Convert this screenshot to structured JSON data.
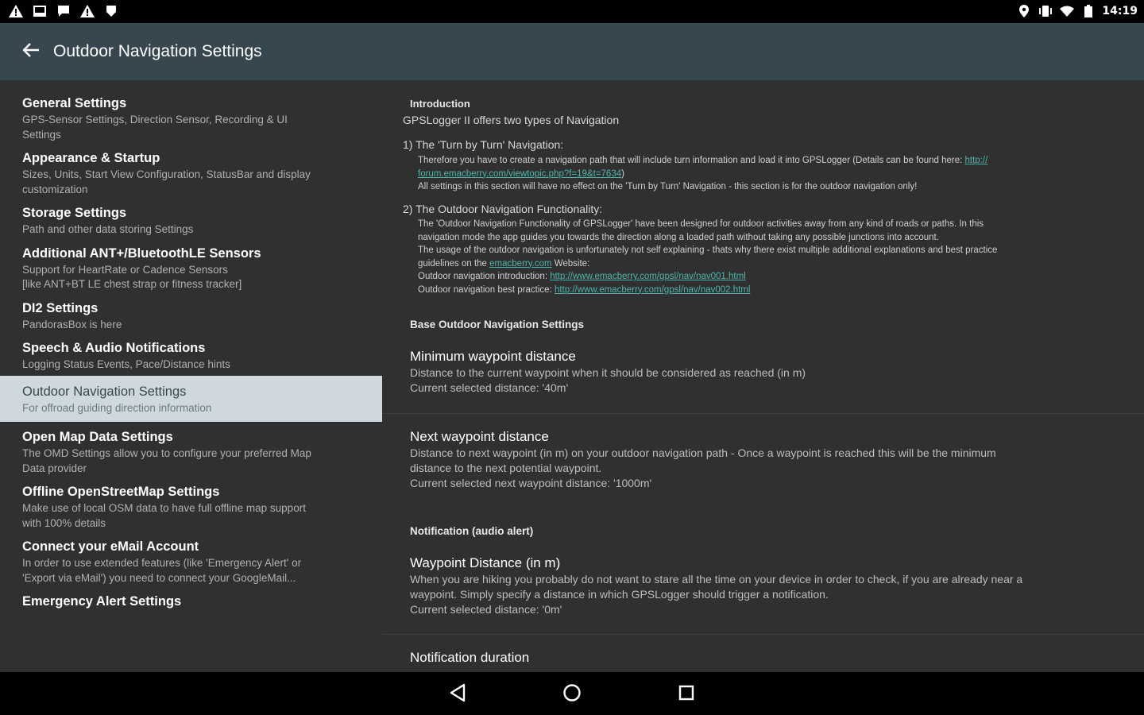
{
  "status_bar": {
    "left_icons": [
      "warning-icon",
      "image-icon",
      "chat-icon",
      "warning-icon",
      "alert-pin-icon"
    ],
    "right_icons": [
      "location-icon",
      "vibrate-icon",
      "wifi-icon",
      "battery-icon"
    ],
    "time": "14:19"
  },
  "app_bar": {
    "title": "Outdoor Navigation Settings",
    "back_icon": "arrow-back-icon",
    "background": "#37474f"
  },
  "sidebar": {
    "items": [
      {
        "title": "General Settings",
        "subtitle": "GPS-Sensor Settings, Direction Sensor, Recording & UI\nSettings"
      },
      {
        "title": "Appearance & Startup",
        "subtitle": "Sizes, Units, Start View Configuration, StatusBar and display\ncustomization"
      },
      {
        "title": "Storage Settings",
        "subtitle": "Path and other data storing Settings"
      },
      {
        "title": "Additional ANT+/BluetoothLE Sensors",
        "subtitle": "Support for HeartRate or Cadence Sensors\n[like ANT+BT LE chest strap or fitness tracker]"
      },
      {
        "title": "DI2 Settings",
        "subtitle": "PandorasBox is here"
      },
      {
        "title": "Speech & Audio Notifications",
        "subtitle": "Logging Status Events, Pace/Distance hints"
      },
      {
        "title": "Outdoor Navigation Settings",
        "subtitle": "For offroad guiding direction information",
        "selected": true
      },
      {
        "title": "Open Map Data Settings",
        "subtitle": "The OMD Settings allow you to configure your preferred Map\nData provider"
      },
      {
        "title": "Offline OpenStreetMap Settings",
        "subtitle": "Make use of local OSM data to have full offline map support\nwith 100% details"
      },
      {
        "title": "Connect your eMail Account",
        "subtitle": "In order to use extended features (like 'Emergency Alert' or\n'Export via eMail') you need to connect your GoogleMail..."
      },
      {
        "title": "Emergency Alert Settings",
        "subtitle": ""
      }
    ],
    "selected_bg": "#cfd8dc"
  },
  "detail": {
    "intro_header": "Introduction",
    "intro_text": "GPSLogger II offers two types of Navigation",
    "section1_title": "1) The 'Turn by Turn' Navigation:",
    "section1_line1": "Therefore you have to create a navigation path that will include turn information and load it into GPSLogger (Details can be found here: ",
    "section1_link1": "http://",
    "section1_link2": "forum.emacberry.com/viewtopic.php?f=19&t=7634",
    "section1_line2_end": ")",
    "section1_line3": "All settings in this section will have no effect on the 'Turn by Turn' Navigation - this section is for the outdoor navigation only!",
    "section2_title": "2) The Outdoor Navigation Functionality:",
    "section2_line1": "The 'Outdoor Navigation Functionality of GPSLogger' have been designed for outdoor activities away from any kind of roads or paths. In this",
    "section2_line2": "navigation mode the app guides you towards the direction along a loaded path without taking any possible junctions into account.",
    "section2_line3": "The usage of the outdoor navigation is unfortunately not self explaining - thats why there exist multiple additional explanations and best practice",
    "section2_line4_a": "guidelines on the ",
    "section2_line4_link": "emacberry.com",
    "section2_line4_b": " Website:",
    "section2_line5_a": "Outdoor navigation introduction: ",
    "section2_line5_link": "http://www.emacberry.com/gpsl/nav/nav001.html",
    "section2_line6_a": "Outdoor navigation best practice: ",
    "section2_line6_link": "http://www.emacberry.com/gpsl/nav/nav002.html",
    "base_header": "Base Outdoor Navigation Settings",
    "prefs": [
      {
        "title": "Minimum waypoint distance",
        "summary": "Distance to the current waypoint when it should be considered as reached (in m)\nCurrent selected distance: '40m'"
      },
      {
        "title": "Next waypoint distance",
        "summary": "Distance to next waypoint (in m) on your outdoor navigation path - Once a waypoint is reached this will be the minimum\ndistance to the next potential waypoint.\nCurrent selected next waypoint distance: '1000m'"
      }
    ],
    "notif_header": "Notification (audio alert)",
    "notif_prefs": [
      {
        "title": "Waypoint Distance (in m)",
        "summary": "When you are hiking you probably do not want to stare all the time on your device in order to check, if you are already near a\nwaypoint. Simply specify a distance in which GPSLogger should trigger a notification.\nCurrent selected distance: '0m'"
      },
      {
        "title": "Notification duration",
        "summary": ""
      }
    ],
    "link_color": "#4db6ac"
  },
  "nav_bar": {
    "buttons": [
      "back-triangle-icon",
      "home-circle-icon",
      "recents-square-icon"
    ]
  }
}
